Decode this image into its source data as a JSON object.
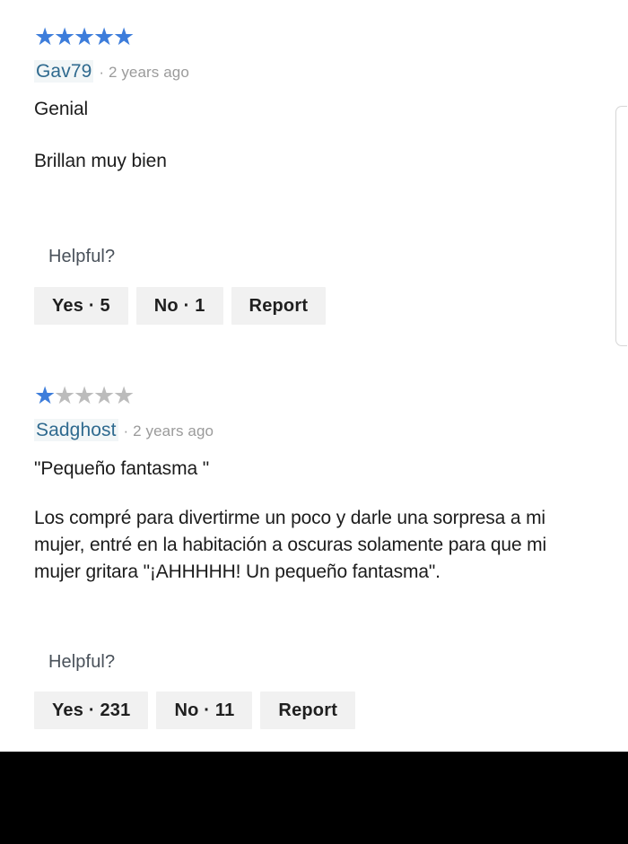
{
  "page": {
    "background_color": "#ffffff",
    "star_on_color": "#3d7ddb",
    "star_off_color": "#bcbcbc",
    "author_link_color": "#2f6a8f",
    "meta_text_color": "#9b9b9b",
    "button_background_color": "#f1f1f1",
    "bottom_bar_color": "#000000"
  },
  "reviews": [
    {
      "rating": 5,
      "max_rating": 5,
      "author": "Gav79",
      "meta": "· 2 years ago",
      "title": "Genial",
      "body": "Brillan muy bien",
      "helpful_label": "Helpful?",
      "buttons": {
        "yes": "Yes · 5",
        "no": "No · 1",
        "report": "Report"
      }
    },
    {
      "rating": 1,
      "max_rating": 5,
      "author": "Sadghost",
      "meta": "· 2 years ago",
      "title": "\"Pequeño fantasma \"",
      "body": "Los compré para divertirme un poco y darle una sorpresa a mi mujer, entré en la habitación a oscuras solamente para que mi mujer gritara \"¡AHHHHH! Un pequeño fantasma\".",
      "helpful_label": "Helpful?",
      "buttons": {
        "yes": "Yes · 231",
        "no": "No · 11",
        "report": "Report"
      }
    }
  ],
  "scrollbar": {
    "icon": "scrollbar-thumb"
  }
}
